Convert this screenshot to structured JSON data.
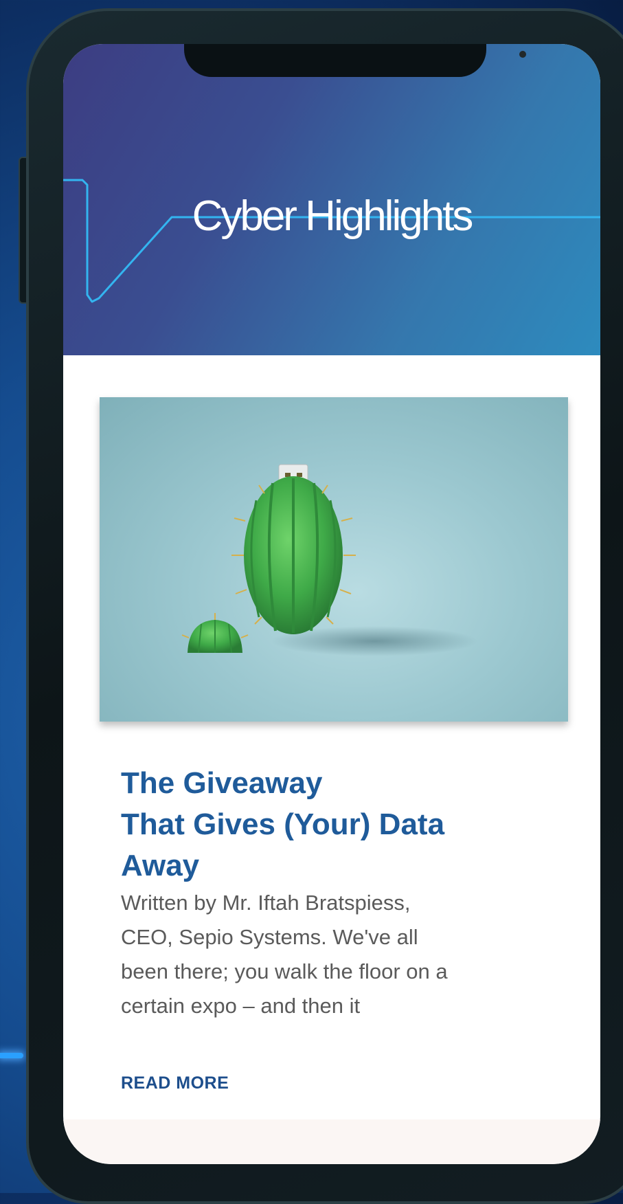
{
  "header": {
    "title": "Cyber Highlights"
  },
  "article": {
    "image_alt": "Cactus-shaped USB drive",
    "title_lines": [
      "The Giveaway",
      "That Gives (Your) Data",
      "Away"
    ],
    "excerpt_lines": [
      "Written by Mr. Iftah Bratspiess,",
      "CEO, Sepio Systems. We've all",
      "been there; you walk the floor on a",
      "certain expo – and then it"
    ],
    "read_more_label": "READ MORE"
  },
  "colors": {
    "header_start": "#3c3d82",
    "header_end": "#2d8bbe",
    "title": "#1f5b9a",
    "link": "#1d4e8c",
    "body_text": "#5a5a5a"
  },
  "icons": {
    "phone_notch": "notch",
    "header_decoration": "circuit-line"
  }
}
